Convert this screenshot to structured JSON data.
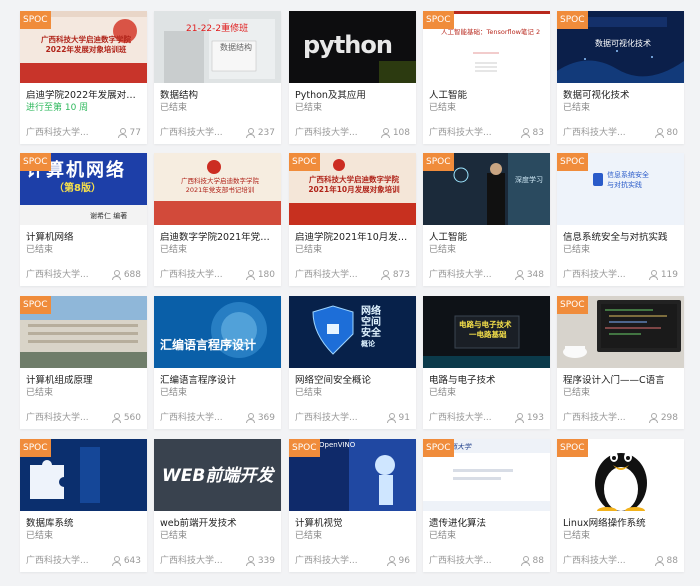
{
  "badge_label": "SPOC",
  "colors": {
    "badge": "#f08c3b",
    "active_status": "#2eb85c",
    "muted": "#999999"
  },
  "icons": {
    "participants": "user-icon"
  },
  "courses": [
    {
      "title": "启迪学院2022年发展对象...",
      "status": "进行至第 10 周",
      "school": "广西科技大学...",
      "count": "77",
      "thumb_lines": [
        "广西科技大学启迪数字学院",
        "2022年发展对象培训班"
      ]
    },
    {
      "title": "数据结构",
      "status": "已结束",
      "school": "广西科技大学...",
      "count": "237",
      "thumb_lines": [
        "21-22-2重修班",
        "数据结构"
      ]
    },
    {
      "title": "Python及其应用",
      "status": "已结束",
      "school": "广西科技大学...",
      "count": "108",
      "thumb_lines": [
        "python"
      ]
    },
    {
      "title": "人工智能",
      "status": "已结束",
      "school": "广西科技大学...",
      "count": "83",
      "thumb_lines": [
        "人工智能基础：Tensorflow笔记 2"
      ]
    },
    {
      "title": "数据可视化技术",
      "status": "已结束",
      "school": "广西科技大学...",
      "count": "80",
      "thumb_lines": [
        "数据可视化技术"
      ]
    },
    {
      "title": "计算机网络",
      "status": "已结束",
      "school": "广西科技大学...",
      "count": "688",
      "thumb_lines": [
        "计算机网络",
        "（第8版）",
        "谢希仁 编著"
      ]
    },
    {
      "title": "启迪数字学院2021年党支...",
      "status": "已结束",
      "school": "广西科技大学...",
      "count": "180",
      "thumb_lines": [
        "广西科技大学启迪数字学院",
        "2021年党支部书记培训"
      ]
    },
    {
      "title": "启迪学院2021年10月发展...",
      "status": "已结束",
      "school": "广西科技大学...",
      "count": "873",
      "thumb_lines": [
        "广西科技大学启迪数字学院",
        "2021年10月发展对象培训"
      ]
    },
    {
      "title": "人工智能",
      "status": "已结束",
      "school": "广西科技大学...",
      "count": "348",
      "thumb_lines": [
        "深度学习"
      ]
    },
    {
      "title": "信息系统安全与对抗实践",
      "status": "已结束",
      "school": "广西科技大学...",
      "count": "119",
      "thumb_lines": [
        "信息系统安全",
        "与对抗实践"
      ]
    },
    {
      "title": "计算机组成原理",
      "status": "已结束",
      "school": "广西科技大学...",
      "count": "560",
      "thumb_lines": []
    },
    {
      "title": "汇编语言程序设计",
      "status": "已结束",
      "school": "广西科技大学...",
      "count": "369",
      "thumb_lines": [
        "汇编语言程序设计"
      ]
    },
    {
      "title": "网络空间安全概论",
      "status": "已结束",
      "school": "广西科技大学...",
      "count": "91",
      "thumb_lines": [
        "网络",
        "空间",
        "安全",
        "概论"
      ]
    },
    {
      "title": "电路与电子技术",
      "status": "已结束",
      "school": "广西科技大学...",
      "count": "193",
      "thumb_lines": [
        "电路与电子技术",
        "一电路基础"
      ]
    },
    {
      "title": "程序设计入门——C语言",
      "status": "已结束",
      "school": "广西科技大学...",
      "count": "298",
      "thumb_lines": []
    },
    {
      "title": "数据库系统",
      "status": "已结束",
      "school": "广西科技大学...",
      "count": "643",
      "thumb_lines": []
    },
    {
      "title": "web前端开发技术",
      "status": "已结束",
      "school": "广西科技大学...",
      "count": "339",
      "thumb_lines": [
        "WEB前端开发"
      ]
    },
    {
      "title": "计算机视觉",
      "status": "已结束",
      "school": "广西科技大学...",
      "count": "96",
      "thumb_lines": [
        "OpenVINO"
      ]
    },
    {
      "title": "遗传进化算法",
      "status": "已结束",
      "school": "广西科技大学...",
      "count": "88",
      "thumb_lines": [
        "广西大学"
      ]
    },
    {
      "title": "Linux网络操作系统",
      "status": "已结束",
      "school": "广西科技大学...",
      "count": "88",
      "thumb_lines": []
    }
  ]
}
